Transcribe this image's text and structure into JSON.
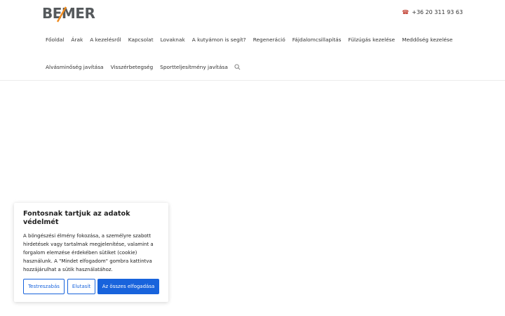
{
  "header": {
    "logo_text": "BEMER",
    "phone": "+36 20 311 93 63",
    "phone_icon": "phone-icon"
  },
  "nav": {
    "row1": [
      "Főoldal",
      "Árak",
      "A kezelésről",
      "Kapcsolat",
      "Lovaknak",
      "A kutyámon is segít?",
      "Regeneráció",
      "Fájdalomcsillapítás",
      "Fülzúgás kezelése",
      "Meddőség kezelése"
    ],
    "row2": [
      "Alvásminőség javítása",
      "Visszérbetegség",
      "Sportteljesítmény javítása"
    ]
  },
  "cookie": {
    "title": "Fontosnak tartjuk az adatok védelmét",
    "text": "A böngészési élmény fokozása, a személyre szabott hirdetések vagy tartalmak megjelenítése, valamint a forgalom elemzése érdekében sütiket (cookie) használunk. A \"Mindet elfogadom\" gombra kattintva hozzájárulhat a sütik használatához.",
    "customize_label": "Testreszabás",
    "reject_label": "Elutasít",
    "accept_label": "Az összes elfogadása"
  },
  "colors": {
    "logo_dark": "#55595c",
    "logo_accent": "#f08a1c",
    "button_blue": "#1863dc"
  }
}
